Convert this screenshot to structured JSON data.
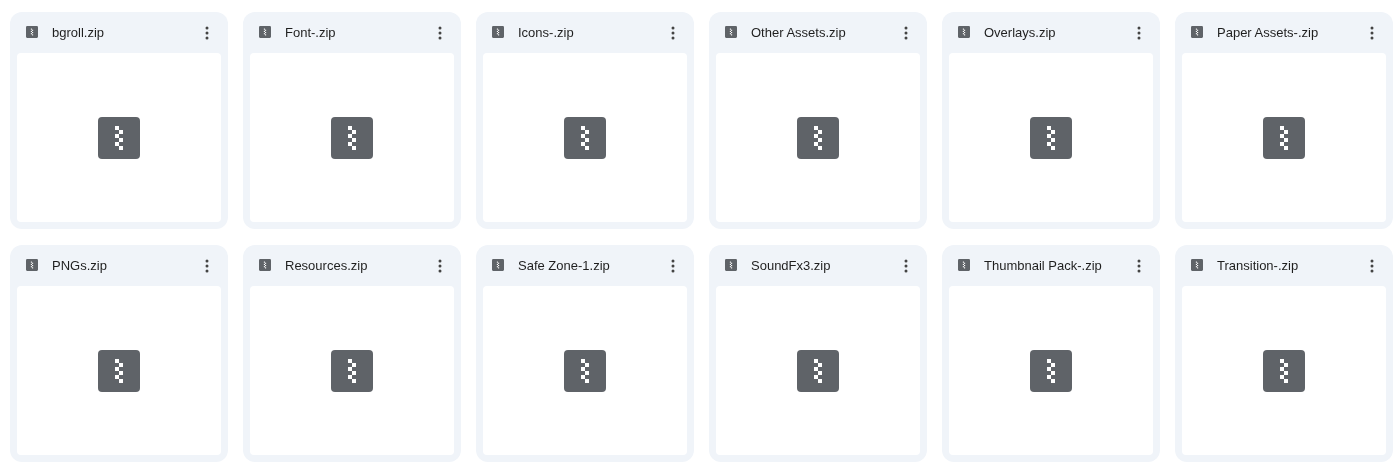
{
  "files": [
    {
      "name": "bgroll.zip",
      "kind": "zip"
    },
    {
      "name": "Font-.zip",
      "kind": "zip"
    },
    {
      "name": "Icons-.zip",
      "kind": "zip"
    },
    {
      "name": "Other Assets.zip",
      "kind": "zip"
    },
    {
      "name": "Overlays.zip",
      "kind": "zip"
    },
    {
      "name": "Paper Assets-.zip",
      "kind": "zip"
    },
    {
      "name": "PNGs.zip",
      "kind": "zip"
    },
    {
      "name": "Resources.zip",
      "kind": "zip"
    },
    {
      "name": "Safe Zone-1.zip",
      "kind": "zip"
    },
    {
      "name": "SoundFx3.zip",
      "kind": "zip"
    },
    {
      "name": "Thumbnail Pack-.zip",
      "kind": "zip"
    },
    {
      "name": "Transition-.zip",
      "kind": "zip"
    }
  ]
}
